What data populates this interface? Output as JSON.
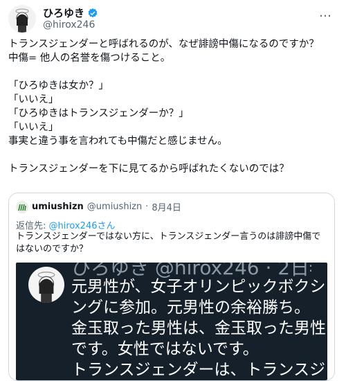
{
  "tweet": {
    "author_name": "ひろゆき",
    "handle": "@hirox246",
    "more_icon": "…",
    "body": "トランスジェンダーと呼ばれるのが、なぜ誹謗中傷になるのですか？\n中傷= 他人の名誉を傷つけること。\n\n「ひろゆきは女か？」\n「いいえ」\n「ひろゆきはトランスジェンダーか？」\n「いいえ」\n事実と違う事を言われても中傷だと感じません。\n\nトランスジェンダーを下に見てるから呼ばれたくないのでは？"
  },
  "quote": {
    "author_name": "umiushizn",
    "handle": "@umiushizn",
    "dot": "·",
    "date": "8月4日",
    "reply_label": "返信先: ",
    "reply_handle": "@hirox246さん",
    "text": "トランスジェンダーではない方に、トランスジェンダー言うのは誹謗中傷ではないのですか？",
    "image": {
      "header": "ひろゆき  @hirox246 · 2日",
      "text": "元男性が、女子オリンピックボクシングに参加。元男性の余裕勝ち。\n金玉取った男性は、金玉取った男性です。女性ではないです。\nトランスジェンダーは、トランスジ"
    }
  },
  "colors": {
    "verified": "#1d9bf0",
    "link": "#1d9bf0",
    "muted": "#536471",
    "dark_bg": "#15202b"
  }
}
